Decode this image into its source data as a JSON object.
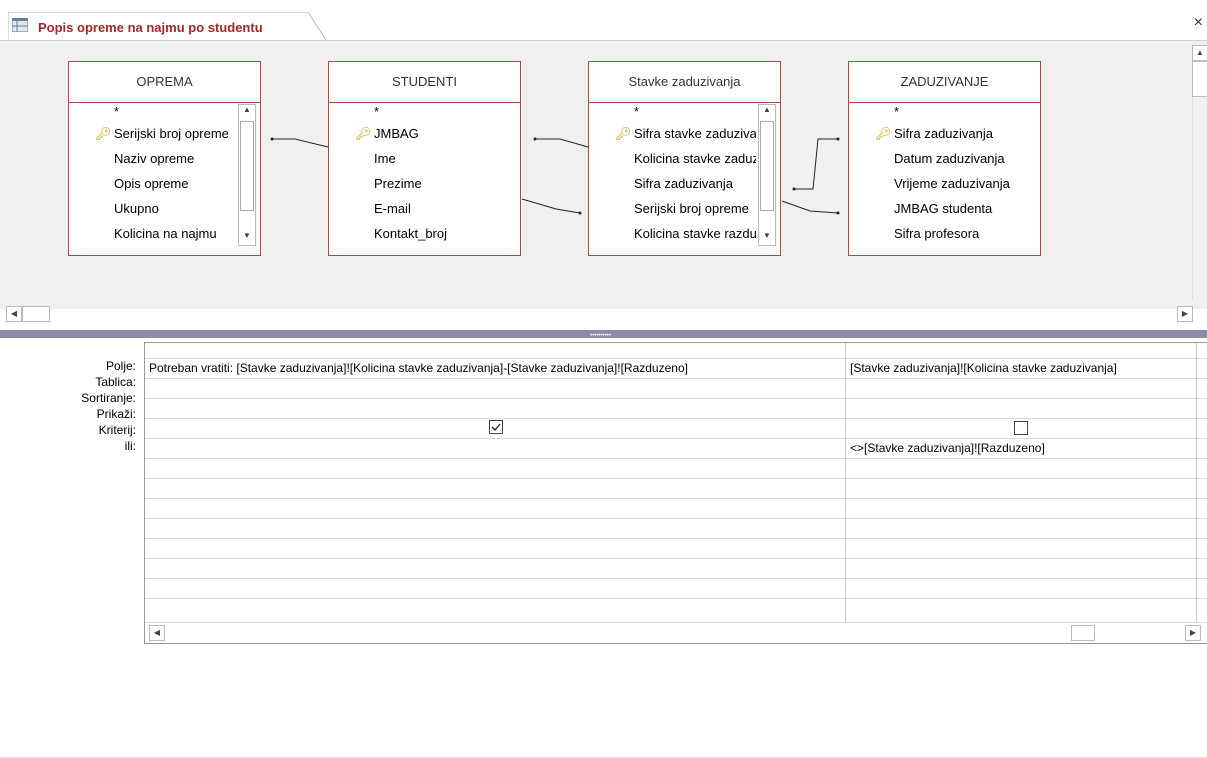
{
  "tab": {
    "title": "Popis opreme na najmu po studentu",
    "close": "×"
  },
  "tables": [
    {
      "name": "OPREMA",
      "fields": [
        "*",
        "Serijski broj opreme",
        "Naziv opreme",
        "Opis opreme",
        "Ukupno",
        "Kolicina na najmu"
      ],
      "key_index": 1,
      "scroll": true
    },
    {
      "name": "STUDENTI",
      "fields": [
        "*",
        "JMBAG",
        "Ime",
        "Prezime",
        "E-mail",
        "Kontakt_broj"
      ],
      "key_index": 1,
      "scroll": false
    },
    {
      "name": "Stavke zaduzivanja",
      "fields": [
        "*",
        "Sifra stavke zaduzivanja",
        "Kolicina stavke zaduzivanja",
        "Sifra zaduzivanja",
        "Serijski broj opreme",
        "Kolicina stavke razduzeno"
      ],
      "key_index": 1,
      "scroll": true
    },
    {
      "name": "ZADUZIVANJE",
      "fields": [
        "*",
        "Sifra zaduzivanja",
        "Datum zaduzivanja",
        "Vrijeme zaduzivanja",
        "JMBAG studenta",
        "Sifra profesora"
      ],
      "key_index": 1,
      "scroll": false
    }
  ],
  "grid": {
    "row_labels": [
      "Polje:",
      "Tablica:",
      "Sortiranje:",
      "Prikaži:",
      "Kriterij:",
      "ili:"
    ],
    "columns": [
      {
        "field": "Potreban vratiti: [Stavke zaduzivanja]![Kolicina stavke zaduzivanja]-[Stavke zaduzivanja]![Razduzeno]",
        "table": "",
        "sort": "",
        "show": true,
        "criteria": ""
      },
      {
        "field": "[Stavke zaduzivanja]![Kolicina stavke zaduzivanja]",
        "table": "",
        "sort": "",
        "show": false,
        "criteria": "<>[Stavke zaduzivanja]![Razduzeno]"
      }
    ]
  },
  "scroll_glyphs": {
    "up": "▲",
    "down": "▼",
    "left": "◀",
    "right": "▶"
  },
  "colors": {
    "accent": "#a4262c",
    "table_border": "#b34444",
    "splitter": "#8c8ca8"
  }
}
